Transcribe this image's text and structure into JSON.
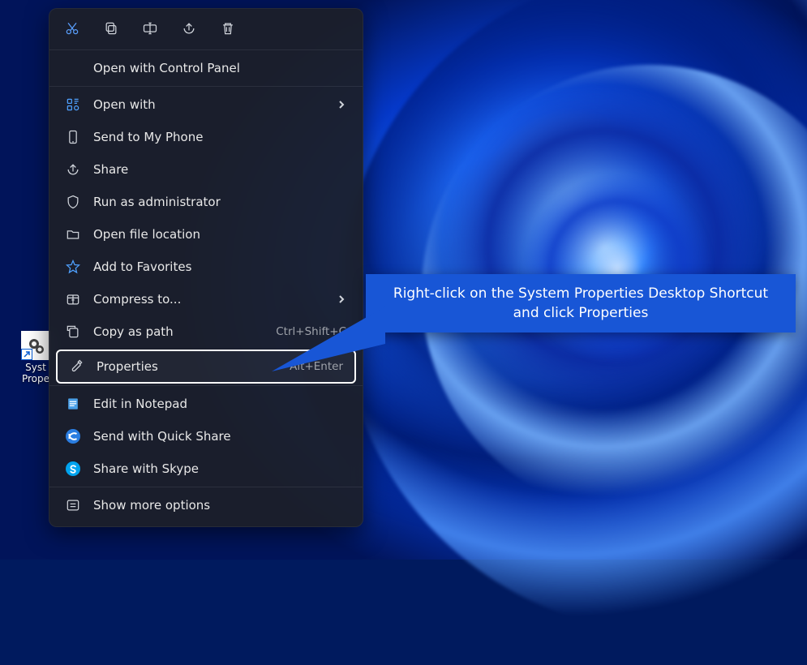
{
  "desktop": {
    "shortcut": {
      "label_line1": "Syst",
      "label_line2": "Prope"
    }
  },
  "context_menu": {
    "top_icons": {
      "cut": "cut-icon",
      "copy": "copy-icon",
      "rename": "rename-icon",
      "share": "share-icon",
      "delete": "delete-icon"
    },
    "default_action": "Open with Control Panel",
    "items": [
      {
        "key": "open-with",
        "label": "Open with",
        "chevron": true
      },
      {
        "key": "send-to-phone",
        "label": "Send to My Phone"
      },
      {
        "key": "share",
        "label": "Share"
      },
      {
        "key": "run-admin",
        "label": "Run as administrator"
      },
      {
        "key": "open-file-location",
        "label": "Open file location"
      },
      {
        "key": "add-favorites",
        "label": "Add to Favorites"
      },
      {
        "key": "compress",
        "label": "Compress to...",
        "chevron": true
      },
      {
        "key": "copy-path",
        "label": "Copy as path",
        "shortcut": "Ctrl+Shift+C"
      },
      {
        "key": "properties",
        "label": "Properties",
        "shortcut": "Alt+Enter",
        "highlight": true
      }
    ],
    "bottom_items": [
      {
        "key": "edit-notepad",
        "label": "Edit in Notepad"
      },
      {
        "key": "quick-share",
        "label": "Send with Quick Share"
      },
      {
        "key": "skype",
        "label": "Share with Skype"
      }
    ],
    "show_more": "Show more options"
  },
  "callout": {
    "line1": "Right-click on the System Properties Desktop Shortcut",
    "line2": "and click Properties"
  }
}
